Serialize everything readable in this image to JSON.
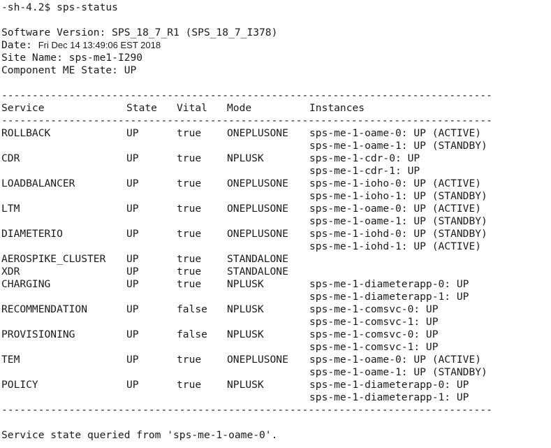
{
  "terminal": {
    "prompt": "-sh-4.2$ sps-status",
    "software_version_label": "Software Version: ",
    "software_version": "SPS_18_7_R1 (SPS_18_7_I378)",
    "date_label": "Date: ",
    "date": "Fri Dec 14 13:49:06 EST 2018",
    "site_name_label": "Site Name: ",
    "site_name": "sps-me1-I290",
    "component_state_label": "Component ME State: ",
    "component_state": "UP",
    "separator": "----------------------------------------------------------------------------------------------------------------",
    "headers": {
      "service": "Service",
      "state": "State",
      "vital": "Vital",
      "mode": "Mode",
      "instances": "Instances"
    },
    "rows": [
      {
        "service": "ROLLBACK",
        "state": "UP",
        "vital": "true",
        "mode": "ONEPLUSONE",
        "instances": [
          "sps-me-1-oame-0: UP (ACTIVE)",
          "sps-me-1-oame-1: UP (STANDBY)"
        ]
      },
      {
        "service": "CDR",
        "state": "UP",
        "vital": "true",
        "mode": "NPLUSK",
        "instances": [
          "sps-me-1-cdr-0: UP",
          "sps-me-1-cdr-1: UP"
        ]
      },
      {
        "service": "LOADBALANCER",
        "state": "UP",
        "vital": "true",
        "mode": "ONEPLUSONE",
        "instances": [
          "sps-me-1-ioho-0: UP (ACTIVE)",
          "sps-me-1-ioho-1: UP (STANDBY)"
        ]
      },
      {
        "service": "LTM",
        "state": "UP",
        "vital": "true",
        "mode": "ONEPLUSONE",
        "instances": [
          "sps-me-1-oame-0: UP (ACTIVE)",
          "sps-me-1-oame-1: UP (STANDBY)"
        ]
      },
      {
        "service": "DIAMETERIO",
        "state": "UP",
        "vital": "true",
        "mode": "ONEPLUSONE",
        "instances": [
          "sps-me-1-iohd-0: UP (STANDBY)",
          "sps-me-1-iohd-1: UP (ACTIVE)"
        ]
      },
      {
        "service": "AEROSPIKE_CLUSTER",
        "state": "UP",
        "vital": "true",
        "mode": "STANDALONE",
        "instances": []
      },
      {
        "service": "XDR",
        "state": "UP",
        "vital": "true",
        "mode": "STANDALONE",
        "instances": []
      },
      {
        "service": "CHARGING",
        "state": "UP",
        "vital": "true",
        "mode": "NPLUSK",
        "instances": [
          "sps-me-1-diameterapp-0: UP",
          "sps-me-1-diameterapp-1: UP"
        ]
      },
      {
        "service": "RECOMMENDATION",
        "state": "UP",
        "vital": "false",
        "mode": "NPLUSK",
        "instances": [
          "sps-me-1-comsvc-0: UP",
          "sps-me-1-comsvc-1: UP"
        ]
      },
      {
        "service": "PROVISIONING",
        "state": "UP",
        "vital": "false",
        "mode": "NPLUSK",
        "instances": [
          "sps-me-1-comsvc-0: UP",
          "sps-me-1-comsvc-1: UP"
        ]
      },
      {
        "service": "TEM",
        "state": "UP",
        "vital": "true",
        "mode": "ONEPLUSONE",
        "instances": [
          "sps-me-1-oame-0: UP (ACTIVE)",
          "sps-me-1-oame-1: UP (STANDBY)"
        ]
      },
      {
        "service": "POLICY",
        "state": "UP",
        "vital": "true",
        "mode": "NPLUSK",
        "instances": [
          "sps-me-1-diameterapp-0: UP",
          "sps-me-1-diameterapp-1: UP"
        ]
      }
    ],
    "footer": "Service state queried from 'sps-me-1-oame-0'."
  }
}
